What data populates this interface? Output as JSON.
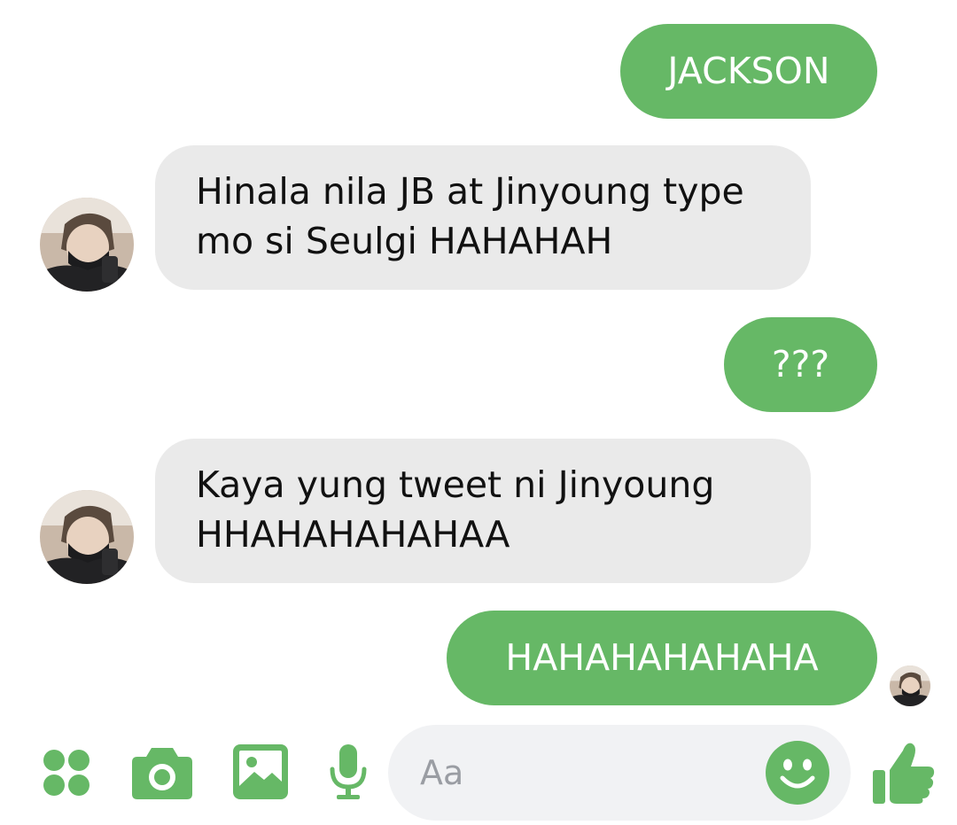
{
  "accent_color": "#66b866",
  "incoming_bubble_color": "#eaeaea",
  "messages": [
    {
      "direction": "outgoing",
      "text": "JACKSON"
    },
    {
      "direction": "incoming",
      "lines": [
        "Hinala nila JB at Jinyoung type",
        "mo si Seulgi HAHAHAH"
      ],
      "avatar": "contact-avatar"
    },
    {
      "direction": "outgoing",
      "text": "???"
    },
    {
      "direction": "incoming",
      "lines": [
        "Kaya yung tweet ni Jinyoung",
        "HHAHAHAHAHAA"
      ],
      "avatar": "contact-avatar"
    },
    {
      "direction": "outgoing",
      "text": "HAHAHAHAHAHA",
      "read_receipt": "contact-avatar"
    }
  ],
  "composer": {
    "placeholder": "Aa"
  },
  "toolbar": {
    "icons": [
      "apps-icon",
      "camera-icon",
      "gallery-icon",
      "microphone-icon",
      "emoji-icon",
      "thumbs-up-icon"
    ]
  }
}
